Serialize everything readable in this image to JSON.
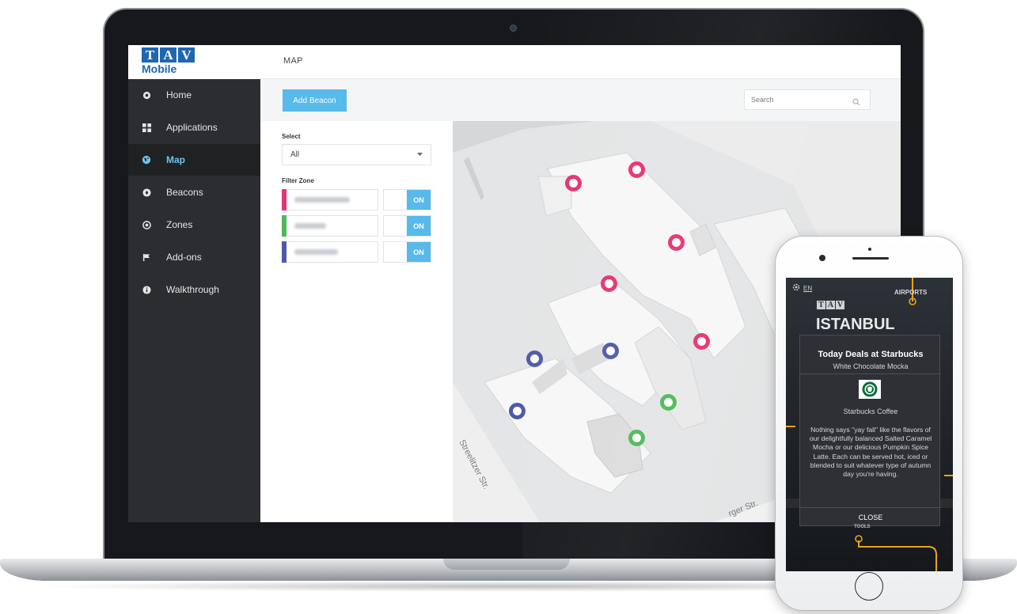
{
  "laptop": {
    "app": {
      "logo": {
        "letters": [
          "T",
          "A",
          "V"
        ],
        "subtitle": "Mobile"
      },
      "sidebar": {
        "items": [
          {
            "label": "Home",
            "icon": "home-icon",
            "active": false
          },
          {
            "label": "Applications",
            "icon": "grid-icon",
            "active": false
          },
          {
            "label": "Map",
            "icon": "globe-icon",
            "active": true
          },
          {
            "label": "Beacons",
            "icon": "beacon-icon",
            "active": false
          },
          {
            "label": "Zones",
            "icon": "target-icon",
            "active": false
          },
          {
            "label": "Add-ons",
            "icon": "flag-icon",
            "active": false
          },
          {
            "label": "Walkthrough",
            "icon": "info-icon",
            "active": false
          }
        ]
      },
      "header": {
        "title": "MAP"
      },
      "toolbar": {
        "add_beacon_label": "Add Beacon",
        "search_placeholder": "Search"
      },
      "filters": {
        "select_label": "Select",
        "select_value": "All",
        "filter_zone_label": "Filter Zone",
        "zones": [
          {
            "color": "#e8336f",
            "toggle": "ON"
          },
          {
            "color": "#4cba57",
            "toggle": "ON"
          },
          {
            "color": "#4e5aa8",
            "toggle": "ON"
          }
        ]
      },
      "map": {
        "street_1": "Streelitzer Str.",
        "street_2": "rger Str.",
        "beacons": [
          {
            "zone": "pink"
          },
          {
            "zone": "pink"
          },
          {
            "zone": "pink"
          },
          {
            "zone": "pink"
          },
          {
            "zone": "pink"
          },
          {
            "zone": "blue"
          },
          {
            "zone": "blue"
          },
          {
            "zone": "blue"
          },
          {
            "zone": "green"
          },
          {
            "zone": "green"
          }
        ]
      }
    }
  },
  "phone": {
    "language": "EN",
    "airports_label": "AIRPORTS",
    "brand_letters": [
      "T",
      "A",
      "V"
    ],
    "city": "ISTANBUL",
    "tools_label": "TOOLS",
    "deal": {
      "title": "Today Deals at Starbucks",
      "subtitle": "White Chocolate Mocka",
      "store": "Starbucks Coffee",
      "body": "Nothing says \"yay fall\" like the flavors of our delightfully balanced Salted Caramel Mocha or our delicious Pumpkin Spice Latte. Each can be served hot, iced or blended to suit whatever type of autumn day you're having.",
      "close_label": "CLOSE"
    }
  },
  "colors": {
    "accent": "#58b9eb",
    "sidebar_bg": "#2b2d30",
    "beacon_pink": "#e8336f",
    "beacon_blue": "#4e5aa8",
    "beacon_green": "#4cba57",
    "route_orange": "#e9a21a"
  }
}
